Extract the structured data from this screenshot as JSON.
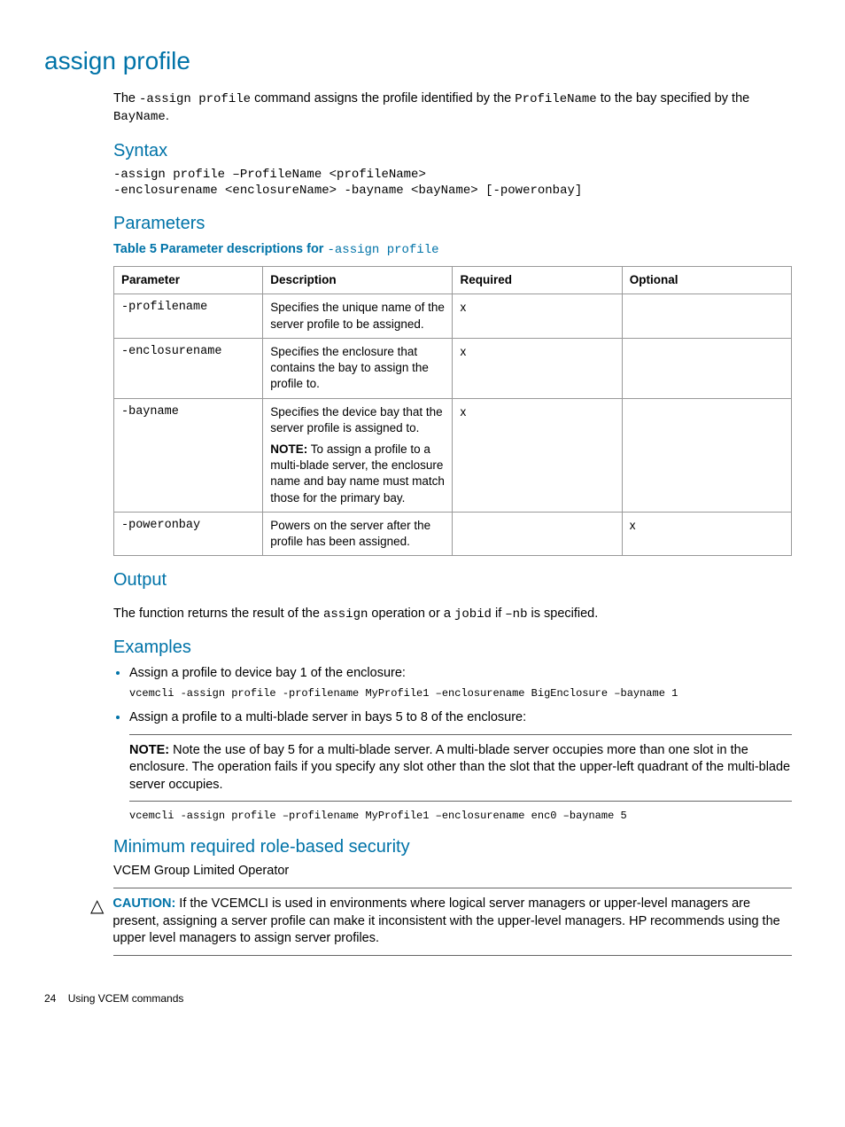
{
  "title": "assign profile",
  "intro": {
    "t1": "The ",
    "c1": "-assign profile",
    "t2": " command assigns the profile identified by the ",
    "c2": "ProfileName",
    "t3": " to the bay specified by the ",
    "c3": "BayName",
    "t4": "."
  },
  "syntax": {
    "heading": "Syntax",
    "code": "-assign profile –ProfileName <profileName>\n-enclosurename <enclosureName> -bayname <bayName> [-poweronbay]"
  },
  "parameters": {
    "heading": "Parameters",
    "caption_prefix": "Table 5 Parameter descriptions for ",
    "caption_code": "-assign profile",
    "headers": [
      "Parameter",
      "Description",
      "Required",
      "Optional"
    ],
    "rows": [
      {
        "param": "-profilename",
        "desc": "Specifies the unique name of the server profile to be assigned.",
        "note_label": "",
        "note": "",
        "req": "x",
        "opt": ""
      },
      {
        "param": "-enclosurename",
        "desc": "Specifies the enclosure that contains the bay to assign the profile to.",
        "note_label": "",
        "note": "",
        "req": "x",
        "opt": ""
      },
      {
        "param": "-bayname",
        "desc": "Specifies the device bay that the server profile is assigned to.",
        "note_label": "NOTE:",
        "note": "   To assign a profile to a multi-blade server, the enclosure name and bay name must match those for the primary bay.",
        "req": "x",
        "opt": ""
      },
      {
        "param": "-poweronbay",
        "desc": "Powers on the server after the profile has been assigned.",
        "note_label": "",
        "note": "",
        "req": "",
        "opt": "x"
      }
    ]
  },
  "output": {
    "heading": "Output",
    "t1": "The function returns the result of the ",
    "c1": "assign",
    "t2": " operation or a ",
    "c2": "jobid",
    "t3": " if ",
    "c3": "–nb",
    "t4": " is specified."
  },
  "examples": {
    "heading": "Examples",
    "item1": "Assign a profile to device bay 1 of the enclosure:",
    "code1": "vcemcli -assign profile -profilename MyProfile1 –enclosurename BigEnclosure –bayname 1",
    "item2": "Assign a profile to a multi-blade server in bays 5 to 8 of the enclosure:",
    "note_label": "NOTE:",
    "note_body": "    Note the use of bay 5 for a multi-blade server. A multi-blade server occupies more than one slot in the enclosure. The operation fails if you specify any slot other than the slot that the upper-left quadrant of the multi-blade server occupies.",
    "code2": "vcemcli -assign profile –profilename MyProfile1 –enclosurename enc0 –bayname 5"
  },
  "security": {
    "heading": "Minimum required role-based security",
    "role": "VCEM Group Limited Operator"
  },
  "caution": {
    "label": "CAUTION:",
    "body": "   If the VCEMCLI is used in environments where logical server managers or upper-level managers are present, assigning a server profile can make it inconsistent with the upper-level managers. HP recommends using the upper level managers to assign server profiles."
  },
  "footer": {
    "page": "24",
    "chapter": "Using VCEM commands"
  }
}
